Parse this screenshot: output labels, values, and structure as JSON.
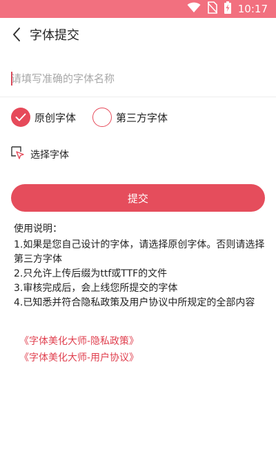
{
  "status_bar": {
    "time": "10:17",
    "background": "#f2707f",
    "icons": [
      "wifi-icon",
      "no-sim-icon",
      "battery-charging-icon"
    ]
  },
  "app_bar": {
    "title": "字体提交",
    "back_icon": "chevron-left-icon"
  },
  "font_name_input": {
    "value": "",
    "placeholder": "请填写准确的字体名称"
  },
  "font_type": {
    "options": [
      {
        "label": "原创字体",
        "selected": true
      },
      {
        "label": "第三方字体",
        "selected": false
      }
    ]
  },
  "select_font": {
    "label": "选择字体",
    "icon": "cursor-select-icon"
  },
  "submit": {
    "label": "提交",
    "color": "#e54d5c"
  },
  "usage": {
    "title": "使用说明：",
    "items": [
      "1.如果是您自己设计的字体，请选择原创字体。否则请选择第三方字体",
      "2.只允许上传后缀为ttf或TTF的文件",
      "3.审核完成后，会上线您所提交的字体",
      "4.已知悉并符合隐私政策及用户协议中所规定的全部内容"
    ]
  },
  "links": {
    "privacy": "《字体美化大师-隐私政策》",
    "agreement": "《字体美化大师-用户协议》",
    "color": "#e0404f"
  }
}
